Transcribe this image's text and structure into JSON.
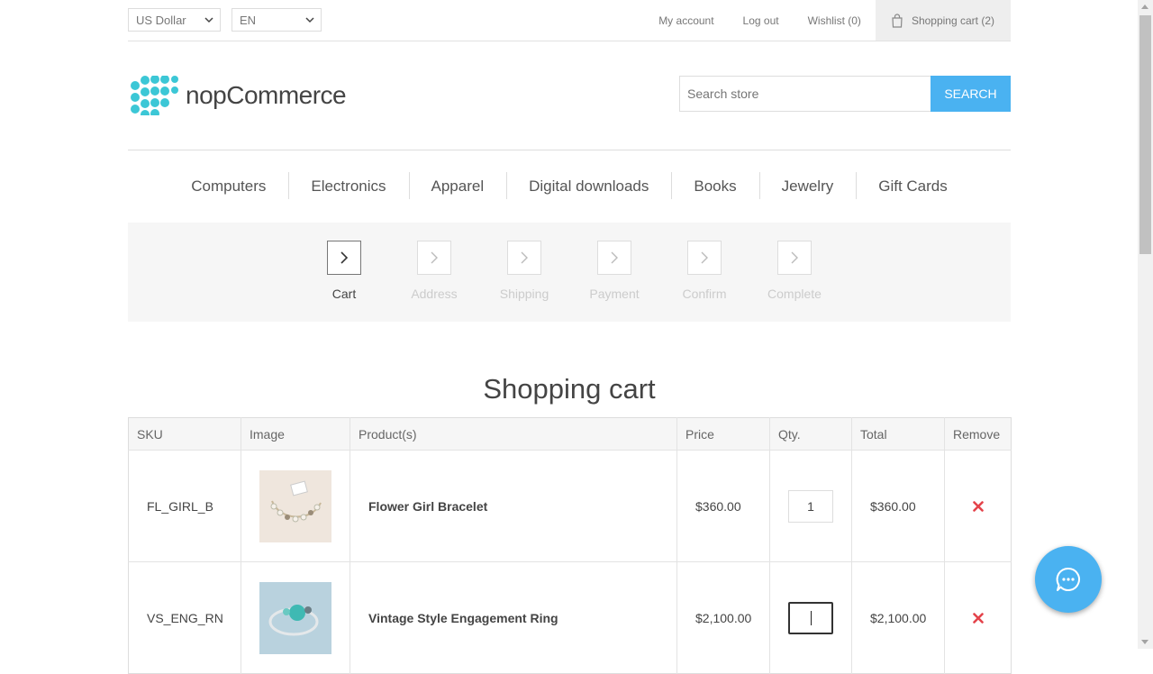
{
  "header": {
    "currency": "US Dollar",
    "language": "EN",
    "links": {
      "my_account": "My account",
      "log_out": "Log out",
      "wishlist": "Wishlist (0)",
      "cart": "Shopping cart (2)"
    }
  },
  "logo": {
    "text": "nopCommerce"
  },
  "search": {
    "placeholder": "Search store",
    "button": "SEARCH"
  },
  "menu": [
    "Computers",
    "Electronics",
    "Apparel",
    "Digital downloads",
    "Books",
    "Jewelry",
    "Gift Cards"
  ],
  "steps": [
    "Cart",
    "Address",
    "Shipping",
    "Payment",
    "Confirm",
    "Complete"
  ],
  "active_step": "Cart",
  "page_title": "Shopping cart",
  "table": {
    "headers": {
      "sku": "SKU",
      "image": "Image",
      "product": "Product(s)",
      "price": "Price",
      "qty": "Qty.",
      "total": "Total",
      "remove": "Remove"
    },
    "rows": [
      {
        "sku": "FL_GIRL_B",
        "product": "Flower Girl Bracelet",
        "price": "$360.00",
        "qty": "1",
        "total": "$360.00"
      },
      {
        "sku": "VS_ENG_RN",
        "product": "Vintage Style Engagement Ring",
        "price": "$2,100.00",
        "qty": "",
        "total": "$2,100.00"
      }
    ]
  },
  "colors": {
    "accent": "#4ab2f1",
    "remove": "#e4434b",
    "logo_dots": "#3cc7d6"
  }
}
